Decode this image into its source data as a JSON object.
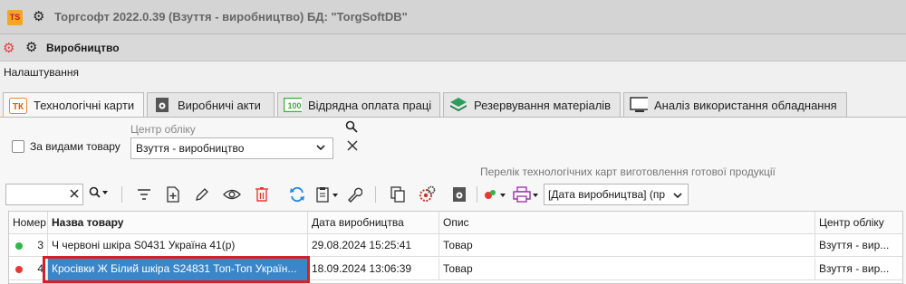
{
  "window": {
    "logo_text": "TS",
    "title": "Торгсофт 2022.0.39 (Взуття - виробництво) БД: \"TorgSoftDB\""
  },
  "module": {
    "title": "Виробництво"
  },
  "menu": {
    "settings": "Налаштування"
  },
  "tabs": [
    {
      "label": "Технологічні карти",
      "icon": "tk-icon",
      "active": true
    },
    {
      "label": "Виробничі акти",
      "icon": "production-act-icon",
      "active": false
    },
    {
      "label": "Відрядна оплата праці",
      "icon": "piecework-pay-icon",
      "active": false
    },
    {
      "label": "Резервування матеріалів",
      "icon": "layers-icon",
      "active": false
    },
    {
      "label": "Аналіз використання обладнання",
      "icon": "monitor-icon",
      "active": false
    }
  ],
  "tab_icon_text": "ТК",
  "pay_icon_text": "100",
  "filters": {
    "by_product_types_label": "За видами товару",
    "by_product_types_checked": false,
    "accounting_center_label": "Центр обліку",
    "accounting_center_value": "Взуття - виробництво"
  },
  "description": "Перелік технологічних карт виготовлення готової продукції",
  "toolbar": {
    "search_value": "",
    "sort_value": "[Дата виробництва] (пр"
  },
  "table": {
    "columns": [
      "Номер",
      "Назва товару",
      "Дата виробництва",
      "Опис",
      "Центр обліку"
    ],
    "rows": [
      {
        "status_color": "#2fb84a",
        "number": "3",
        "name": "Ч червоні шкіра S0431 Україна 41(р)",
        "date": "29.08.2024 15:25:41",
        "description": "Товар",
        "center": "Взуття - вир..."
      },
      {
        "status_color": "#e53935",
        "number": "4",
        "name": "Кросівки Ж Білий шкіра S24831 Топ-Топ Україн...",
        "date": "18.09.2024 13:06:39",
        "description": "Товар",
        "center": "Взуття - вир..."
      }
    ]
  },
  "colors": {
    "selection": "#3a86c8",
    "highlight_frame": "#d61f26",
    "delete_red": "#e53935",
    "refresh_blue": "#1e88e5",
    "purple": "#9c27b0"
  }
}
